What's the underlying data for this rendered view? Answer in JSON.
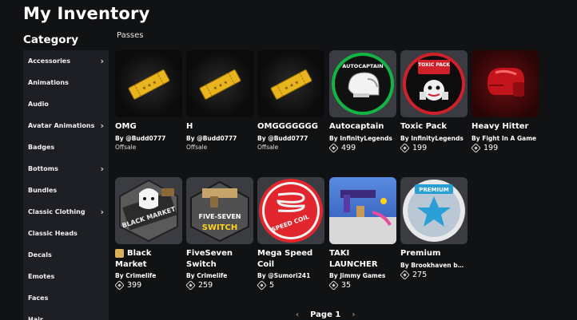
{
  "header": {
    "title": "My Inventory"
  },
  "category": {
    "heading": "Category",
    "items": [
      {
        "label": "Accessories",
        "chevron": true
      },
      {
        "label": "Animations",
        "chevron": false
      },
      {
        "label": "Audio",
        "chevron": false
      },
      {
        "label": "Avatar Animations",
        "chevron": true
      },
      {
        "label": "Badges",
        "chevron": false
      },
      {
        "label": "Bottoms",
        "chevron": true
      },
      {
        "label": "Bundles",
        "chevron": false
      },
      {
        "label": "Classic Clothing",
        "chevron": true
      },
      {
        "label": "Classic Heads",
        "chevron": false
      },
      {
        "label": "Decals",
        "chevron": false
      },
      {
        "label": "Emotes",
        "chevron": false
      },
      {
        "label": "Faces",
        "chevron": false
      },
      {
        "label": "Hair",
        "chevron": false
      }
    ]
  },
  "section": {
    "label": "Passes"
  },
  "passes": [
    {
      "name": "OMG",
      "creator": "By @Budd0777",
      "status": "Offsale",
      "price": null,
      "art": "ticket"
    },
    {
      "name": "H",
      "creator": "By @Budd0777",
      "status": "Offsale",
      "price": null,
      "art": "ticket"
    },
    {
      "name": "OMGGGGGGG",
      "creator": "By @Budd0777",
      "status": "Offsale",
      "price": null,
      "art": "ticket"
    },
    {
      "name": "Autocaptain",
      "creator": "By InfinityLegends",
      "status": null,
      "price": "499",
      "art": "autocaptain",
      "art_text": "AUTOCAPTAIN"
    },
    {
      "name": "Toxic Pack",
      "creator": "By InfinityLegends",
      "status": null,
      "price": "199",
      "art": "toxic",
      "art_text": "TOXIC PACK"
    },
    {
      "name": "Heavy Hitter",
      "creator": "By Fight In A Game",
      "status": null,
      "price": "199",
      "art": "heavy"
    },
    {
      "name": "Black Market",
      "creator": "By Crimelife",
      "status": null,
      "price": "399",
      "art": "blackmarket",
      "art_text": "BLACK MARKET",
      "badge": true
    },
    {
      "name": "FiveSeven Switch",
      "creator": "By Crimelife",
      "status": null,
      "price": "259",
      "art": "fiveseven",
      "art_text_1": "FIVE-SEVEN",
      "art_text_2": "SWITCH"
    },
    {
      "name": "Mega Speed Coil",
      "creator": "By @Sumori241",
      "status": null,
      "price": "5",
      "art": "speedcoil",
      "art_text": "SPEED COIL"
    },
    {
      "name": "TAKI LAUNCHER",
      "creator": "By Jimmy Games",
      "status": null,
      "price": "35",
      "art": "taki"
    },
    {
      "name": "Premium",
      "creator": "By Brookhaven by V...",
      "status": null,
      "price": "275",
      "art": "premium",
      "art_text": "PREMIUM"
    }
  ],
  "pagination": {
    "label": "Page 1",
    "prev": "‹",
    "next": "›"
  },
  "colors": {
    "background": "#111214",
    "sidebar": "#1d1f24",
    "thumb": "#3a3c42",
    "toxic_red": "#d0202a",
    "premium_blue": "#2a9fd6"
  }
}
